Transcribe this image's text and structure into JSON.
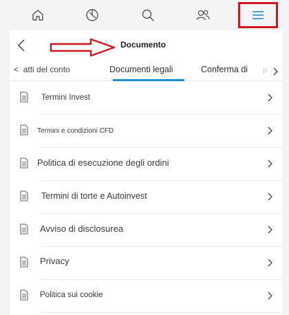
{
  "nav": {
    "items": [
      {
        "name": "home-icon"
      },
      {
        "name": "portfolio-icon"
      },
      {
        "name": "search-icon"
      },
      {
        "name": "people-icon"
      },
      {
        "name": "menu-icon",
        "highlighted": true
      }
    ]
  },
  "header": {
    "title": "Documento"
  },
  "tabs": {
    "prev_label": "atti del conto",
    "prev_chevron": "<",
    "active_label": "Documenti legali",
    "next_label": "Conferma di",
    "faded_label": "p",
    "accent": "#1f8ccf"
  },
  "documents": [
    {
      "label": "Termini Invest"
    },
    {
      "label": "Termini e condizioni CFD"
    },
    {
      "label": "Politica di esecuzione degli ordini"
    },
    {
      "label": "Termini di torte e Autoinvest"
    },
    {
      "label": "Avviso di disclosurea"
    },
    {
      "label": "Privacy"
    },
    {
      "label": "Politica sui cookie"
    }
  ],
  "colors": {
    "highlight_box": "#d0161f",
    "menu_icon": "#1f8ccf"
  }
}
